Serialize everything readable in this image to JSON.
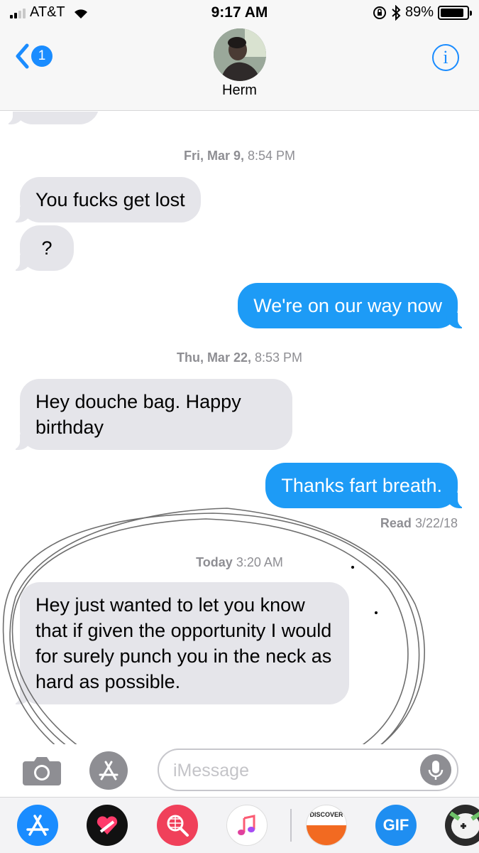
{
  "status_bar": {
    "carrier": "AT&T",
    "time": "9:17 AM",
    "battery_percent": "89%",
    "battery_level": 0.89,
    "signal_bars_active": 2,
    "icons": [
      "signal-icon",
      "wifi-icon",
      "rotation-lock-icon",
      "bluetooth-icon",
      "battery-icon"
    ]
  },
  "header": {
    "back_badge": "1",
    "contact_name": "Herm",
    "info_icon": "i"
  },
  "thread": {
    "timestamps": [
      {
        "day": "Fri, Mar 9,",
        "time": "8:54 PM"
      },
      {
        "day": "Thu, Mar 22,",
        "time": "8:53 PM"
      },
      {
        "day": "Today",
        "time": "3:20 AM"
      }
    ],
    "messages": [
      {
        "direction": "incoming",
        "text": "You fucks get lost"
      },
      {
        "direction": "incoming",
        "text": "?"
      },
      {
        "direction": "outgoing",
        "text": "We're on our way now"
      },
      {
        "direction": "incoming",
        "text": "Hey douche bag. Happy birthday"
      },
      {
        "direction": "outgoing",
        "text": "Thanks fart breath."
      },
      {
        "direction": "incoming",
        "text": "Hey just wanted to let you know that if given the opportunity I would for surely punch you in the neck as hard as possible."
      }
    ],
    "read_receipt": {
      "label": "Read",
      "date": "3/22/18"
    }
  },
  "input_bar": {
    "placeholder": "iMessage"
  },
  "app_drawer": {
    "apps": [
      {
        "name": "app-store-icon",
        "color": "#1a8cff"
      },
      {
        "name": "digital-touch-icon",
        "color": "#111111"
      },
      {
        "name": "web-images-icon",
        "color": "#f0405a"
      },
      {
        "name": "music-icon",
        "color": "#ffffff"
      },
      {
        "name": "discover-icon",
        "label": "DISCOVER",
        "color": "#f26a21"
      },
      {
        "name": "gif-icon",
        "label": "GIF",
        "color": "#1f8ef1"
      },
      {
        "name": "game-icon",
        "color": "#2a2a2a"
      }
    ]
  },
  "colors": {
    "incoming_bubble": "#e5e5ea",
    "outgoing_bubble": "#1d9bf6",
    "ios_blue": "#1a8cff",
    "timestamp_gray": "#8e8e93"
  }
}
